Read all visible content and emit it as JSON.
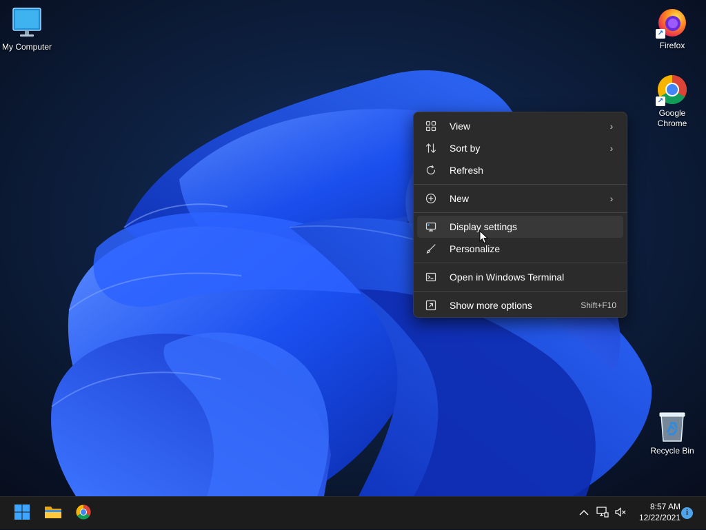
{
  "desktop": {
    "icons": [
      {
        "label": "My Computer",
        "icon": "monitor-icon"
      },
      {
        "label": "Firefox",
        "icon": "firefox-icon"
      },
      {
        "label": "Google Chrome",
        "icon": "chrome-icon"
      },
      {
        "label": "Recycle Bin",
        "icon": "recycle-bin-icon"
      }
    ]
  },
  "context_menu": {
    "items": [
      {
        "label": "View",
        "icon": "view-grid-icon",
        "submenu": true
      },
      {
        "label": "Sort by",
        "icon": "sort-icon",
        "submenu": true
      },
      {
        "label": "Refresh",
        "icon": "refresh-icon"
      },
      {
        "label": "New",
        "icon": "new-plus-icon",
        "submenu": true
      },
      {
        "label": "Display settings",
        "icon": "display-settings-icon",
        "hovered": true
      },
      {
        "label": "Personalize",
        "icon": "brush-icon"
      },
      {
        "label": "Open in Windows Terminal",
        "icon": "terminal-icon"
      },
      {
        "label": "Show more options",
        "icon": "more-options-icon",
        "shortcut": "Shift+F10"
      }
    ],
    "submenu_arrow": "›"
  },
  "taskbar": {
    "apps": [
      "start-icon",
      "file-explorer-icon",
      "chrome-icon"
    ],
    "tray": {
      "chevron": "^",
      "time": "8:57 AM",
      "date": "12/22/2021",
      "notification_badge": "i"
    }
  },
  "colors": {
    "menu_bg": "#2b2b2b",
    "menu_hover": "#383838",
    "taskbar_bg": "#1c1c1c",
    "wallpaper_blue": "#1b4fe0"
  }
}
